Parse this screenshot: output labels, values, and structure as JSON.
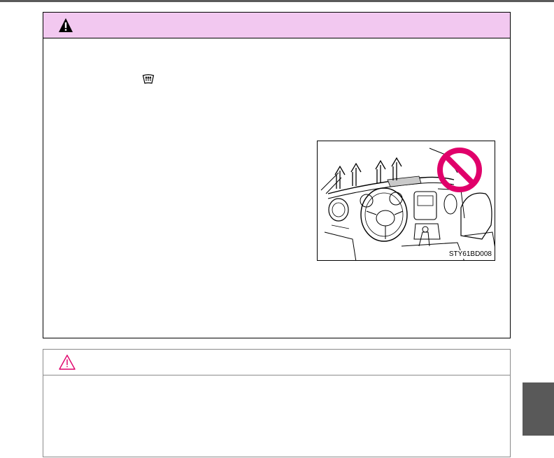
{
  "page": {
    "accent_warning_header": "#f2c8f0",
    "accent_notice_icon": "#e0006a",
    "side_tab_color": "#595959"
  },
  "warning": {
    "icon": "warning-triangle-icon",
    "inline_icon": "windshield-defogger-icon"
  },
  "figure": {
    "code": "STY61BD008",
    "prohibition_icon": "prohibition-icon",
    "arrow_icons": [
      "up-arrow-icon",
      "up-arrow-icon",
      "up-arrow-icon",
      "up-arrow-icon"
    ]
  },
  "notice": {
    "icon": "caution-triangle-icon"
  }
}
